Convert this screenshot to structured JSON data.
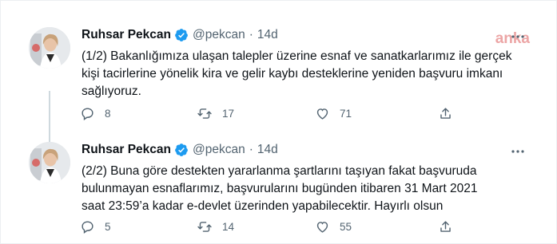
{
  "watermark": "anka",
  "colors": {
    "verified": "#1d9bf0",
    "muted": "#536471",
    "text": "#0f1419"
  },
  "tweets": [
    {
      "name": "Ruhsar Pekcan",
      "handle": "@pekcan",
      "separator": "·",
      "time": "14d",
      "text": "(1/2) Bakanlığımıza ulaşan talepler üzerine esnaf ve sanatkarlarımız ile gerçek\nkişi tacirlerine yönelik kira ve gelir kaybı desteklerine yeniden başvuru imkanı\nsağlıyoruz.",
      "replies": "8",
      "retweets": "17",
      "likes": "71"
    },
    {
      "name": "Ruhsar Pekcan",
      "handle": "@pekcan",
      "separator": "·",
      "time": "14d",
      "text": "(2/2) Buna göre destekten yararlanma şartlarını taşıyan fakat başvuruda\nbulunmayan esnaflarımız,  başvurularını bugünden itibaren 31 Mart 2021\nsaat 23:59’a kadar e-devlet üzerinden yapabilecektir. Hayırlı olsun",
      "replies": "5",
      "retweets": "14",
      "likes": "55"
    }
  ],
  "icons": {
    "verified": "verified-badge-icon",
    "more": "more-options-icon",
    "reply": "reply-icon",
    "retweet": "retweet-icon",
    "like": "heart-icon",
    "share": "share-icon"
  }
}
